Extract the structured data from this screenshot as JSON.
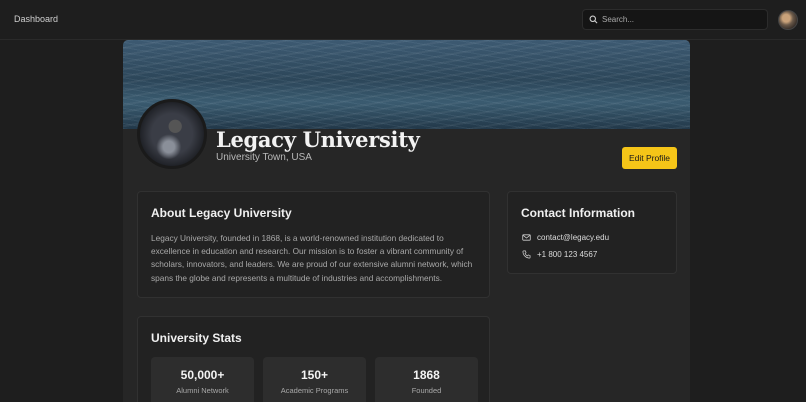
{
  "nav": {
    "dashboard_label": "Dashboard"
  },
  "search": {
    "placeholder": "Search...",
    "value": ""
  },
  "profile": {
    "name": "Legacy University",
    "location": "University Town, USA",
    "edit_button_label": "Edit Profile"
  },
  "about": {
    "title": "About Legacy University",
    "text": "Legacy University, founded in 1868, is a world-renowned institution dedicated to excellence in education and research. Our mission is to foster a vibrant community of scholars, innovators, and leaders. We are proud of our extensive alumni network, which spans the globe and represents a multitude of industries and accomplishments."
  },
  "contact": {
    "title": "Contact Information",
    "email": "contact@legacy.edu",
    "phone": "+1 800 123 4567"
  },
  "stats": {
    "title": "University Stats",
    "items": [
      {
        "value": "50,000+",
        "label": "Alumni Network"
      },
      {
        "value": "150+",
        "label": "Academic Programs"
      },
      {
        "value": "1868",
        "label": "Founded"
      }
    ]
  },
  "colors": {
    "accent": "#f5c518",
    "background": "#1e1e1e",
    "card": "#262626"
  },
  "icons": [
    "search-icon",
    "mail-icon",
    "phone-icon"
  ]
}
